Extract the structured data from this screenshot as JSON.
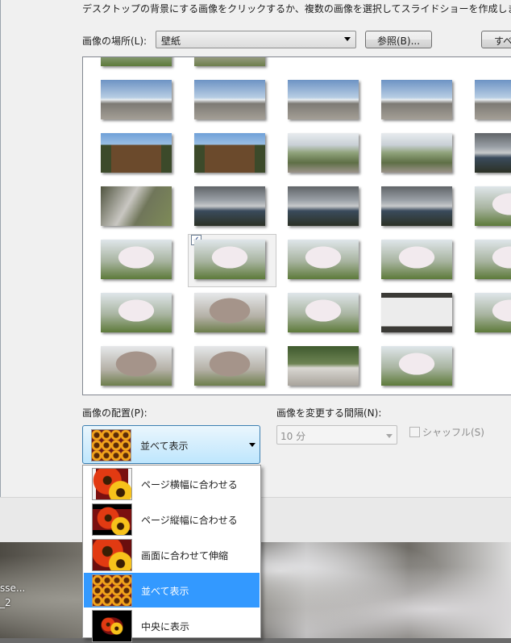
{
  "instruction": "デスクトップの背景にする画像をクリックするか、複数の画像を選択してスライドショーを作成しま",
  "location": {
    "label": "画像の場所(L):",
    "value": "壁紙",
    "browse_label": "参照(B)...",
    "select_all_label": "すべ"
  },
  "gallery": {
    "rows": [
      [
        "beach",
        "beach",
        "beach",
        "beach",
        "beach"
      ],
      [
        "temple",
        "temple",
        "coast",
        "coast",
        "cloud"
      ],
      [
        "rocks",
        "cloud",
        "cloud",
        "cloud",
        "sakura"
      ],
      [
        "sakura",
        "sakura",
        "sakura",
        "sakura",
        "sakura"
      ],
      [
        "sakura",
        "bare",
        "sakura",
        "sign",
        "sakura"
      ],
      [
        "bare",
        "bare",
        "building",
        "sakura"
      ]
    ],
    "selected_checkbox": "✓"
  },
  "position": {
    "label": "画像の配置(P):",
    "selected": "並べて表示",
    "icon": "tile-icon"
  },
  "interval": {
    "label": "画像を変更する間隔(N):",
    "value": "10 分",
    "shuffle_label": "シャッフル(S)"
  },
  "dropdown": {
    "options": [
      {
        "label": "ページ横幅に合わせる",
        "icon": "fit-width-icon"
      },
      {
        "label": "ページ縦幅に合わせる",
        "icon": "fit-height-icon"
      },
      {
        "label": "画面に合わせて伸縮",
        "icon": "stretch-icon"
      },
      {
        "label": "並べて表示",
        "icon": "tile-icon",
        "selected": true
      },
      {
        "label": "中央に表示",
        "icon": "center-icon"
      }
    ]
  },
  "desktop": {
    "label1": "sse...",
    "label2": "_2"
  }
}
